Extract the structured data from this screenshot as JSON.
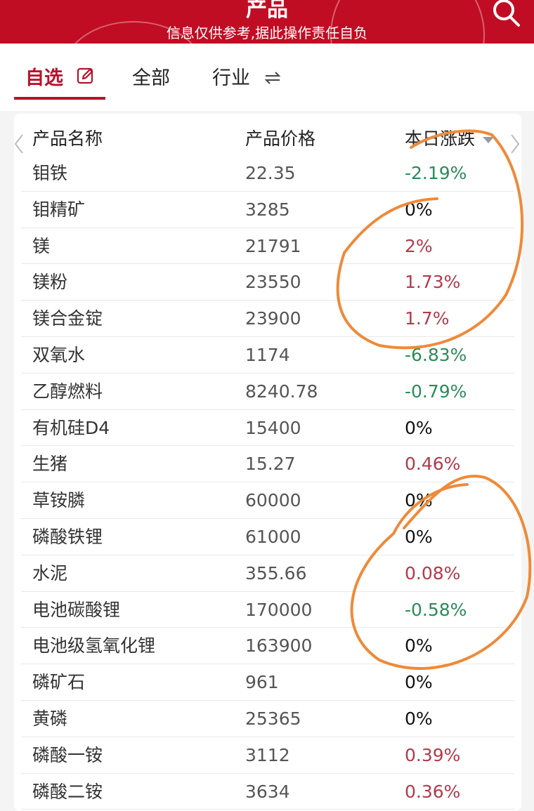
{
  "header": {
    "title": "产品",
    "subtitle": "信息仅供参考,据此操作责任自负",
    "search_icon": "search-icon"
  },
  "tabs": [
    {
      "label": "自选",
      "icon": "edit-icon",
      "active": true
    },
    {
      "label": "全部",
      "active": false
    },
    {
      "label": "行业",
      "icon": "swap-icon",
      "active": false
    }
  ],
  "table": {
    "headers": {
      "name": "产品名称",
      "price": "产品价格",
      "change": "本日涨跌"
    },
    "sort_icon": "sort-down-icon",
    "rows": [
      {
        "name": "钼铁",
        "price": "22.35",
        "change": "-2.19%",
        "trend": "down"
      },
      {
        "name": "钼精矿",
        "price": "3285",
        "change": "0%",
        "trend": "flat"
      },
      {
        "name": "镁",
        "price": "21791",
        "change": "2%",
        "trend": "up"
      },
      {
        "name": "镁粉",
        "price": "23550",
        "change": "1.73%",
        "trend": "up"
      },
      {
        "name": "镁合金锭",
        "price": "23900",
        "change": "1.7%",
        "trend": "up"
      },
      {
        "name": "双氧水",
        "price": "1174",
        "change": "-6.83%",
        "trend": "down"
      },
      {
        "name": "乙醇燃料",
        "price": "8240.78",
        "change": "-0.79%",
        "trend": "down"
      },
      {
        "name": "有机硅D4",
        "price": "15400",
        "change": "0%",
        "trend": "flat"
      },
      {
        "name": "生猪",
        "price": "15.27",
        "change": "0.46%",
        "trend": "up"
      },
      {
        "name": "草铵膦",
        "price": "60000",
        "change": "0%",
        "trend": "flat"
      },
      {
        "name": "磷酸铁锂",
        "price": "61000",
        "change": "0%",
        "trend": "flat"
      },
      {
        "name": "水泥",
        "price": "355.66",
        "change": "0.08%",
        "trend": "up"
      },
      {
        "name": "电池碳酸锂",
        "price": "170000",
        "change": "-0.58%",
        "trend": "down"
      },
      {
        "name": "电池级氢氧化锂",
        "price": "163900",
        "change": "0%",
        "trend": "flat"
      },
      {
        "name": "磷矿石",
        "price": "961",
        "change": "0%",
        "trend": "flat"
      },
      {
        "name": "黄磷",
        "price": "25365",
        "change": "0%",
        "trend": "flat"
      },
      {
        "name": "磷酸一铵",
        "price": "3112",
        "change": "0.39%",
        "trend": "up"
      },
      {
        "name": "磷酸二铵",
        "price": "3634",
        "change": "0.36%",
        "trend": "up"
      }
    ]
  },
  "colors": {
    "brand_red": "#c10d23",
    "up": "#b23a4c",
    "down": "#2d8a5a",
    "flat": "#111111",
    "annotation": "#ee8a3a"
  }
}
